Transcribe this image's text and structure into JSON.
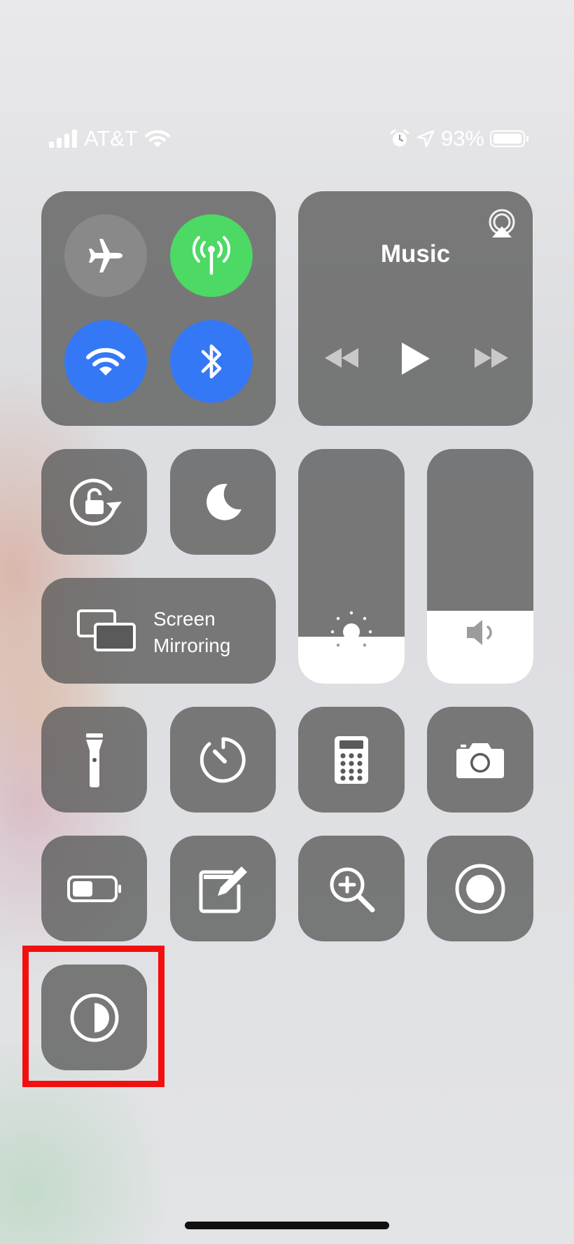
{
  "status_bar": {
    "carrier": "AT&T",
    "battery_percent": "93%",
    "icons": [
      "signal-icon",
      "wifi-icon",
      "alarm-icon",
      "location-icon",
      "battery-icon"
    ]
  },
  "connectivity": {
    "airplane_mode": {
      "icon": "airplane-icon",
      "on": false
    },
    "cellular_data": {
      "icon": "antenna-icon",
      "on": true,
      "color": "#4cd964"
    },
    "wifi": {
      "icon": "wifi-icon",
      "on": true,
      "color": "#3478f6"
    },
    "bluetooth": {
      "icon": "bluetooth-icon",
      "on": true,
      "color": "#3478f6"
    }
  },
  "music": {
    "title": "Music",
    "icons": [
      "airplay-icon",
      "rewind-icon",
      "play-icon",
      "fast-forward-icon"
    ]
  },
  "screen_mirroring": {
    "label_line1": "Screen",
    "label_line2": "Mirroring"
  },
  "brightness": {
    "icon": "sun-icon",
    "level": 0.2
  },
  "volume": {
    "icon": "speaker-icon",
    "level": 0.31
  },
  "controls": [
    {
      "name": "orientation-lock",
      "icon": "rotation-lock-icon"
    },
    {
      "name": "do-not-disturb",
      "icon": "moon-icon"
    },
    {
      "name": "flashlight",
      "icon": "flashlight-icon"
    },
    {
      "name": "timer",
      "icon": "timer-icon"
    },
    {
      "name": "calculator",
      "icon": "calculator-icon"
    },
    {
      "name": "camera",
      "icon": "camera-icon"
    },
    {
      "name": "low-power-mode",
      "icon": "battery-icon"
    },
    {
      "name": "notes",
      "icon": "notes-icon"
    },
    {
      "name": "magnifier",
      "icon": "magnifier-icon"
    },
    {
      "name": "screen-recording",
      "icon": "record-icon"
    },
    {
      "name": "dark-mode",
      "icon": "dark-mode-icon"
    }
  ],
  "colors": {
    "tile_bg": "#5a5a5a",
    "highlight": "#f20f0f"
  }
}
